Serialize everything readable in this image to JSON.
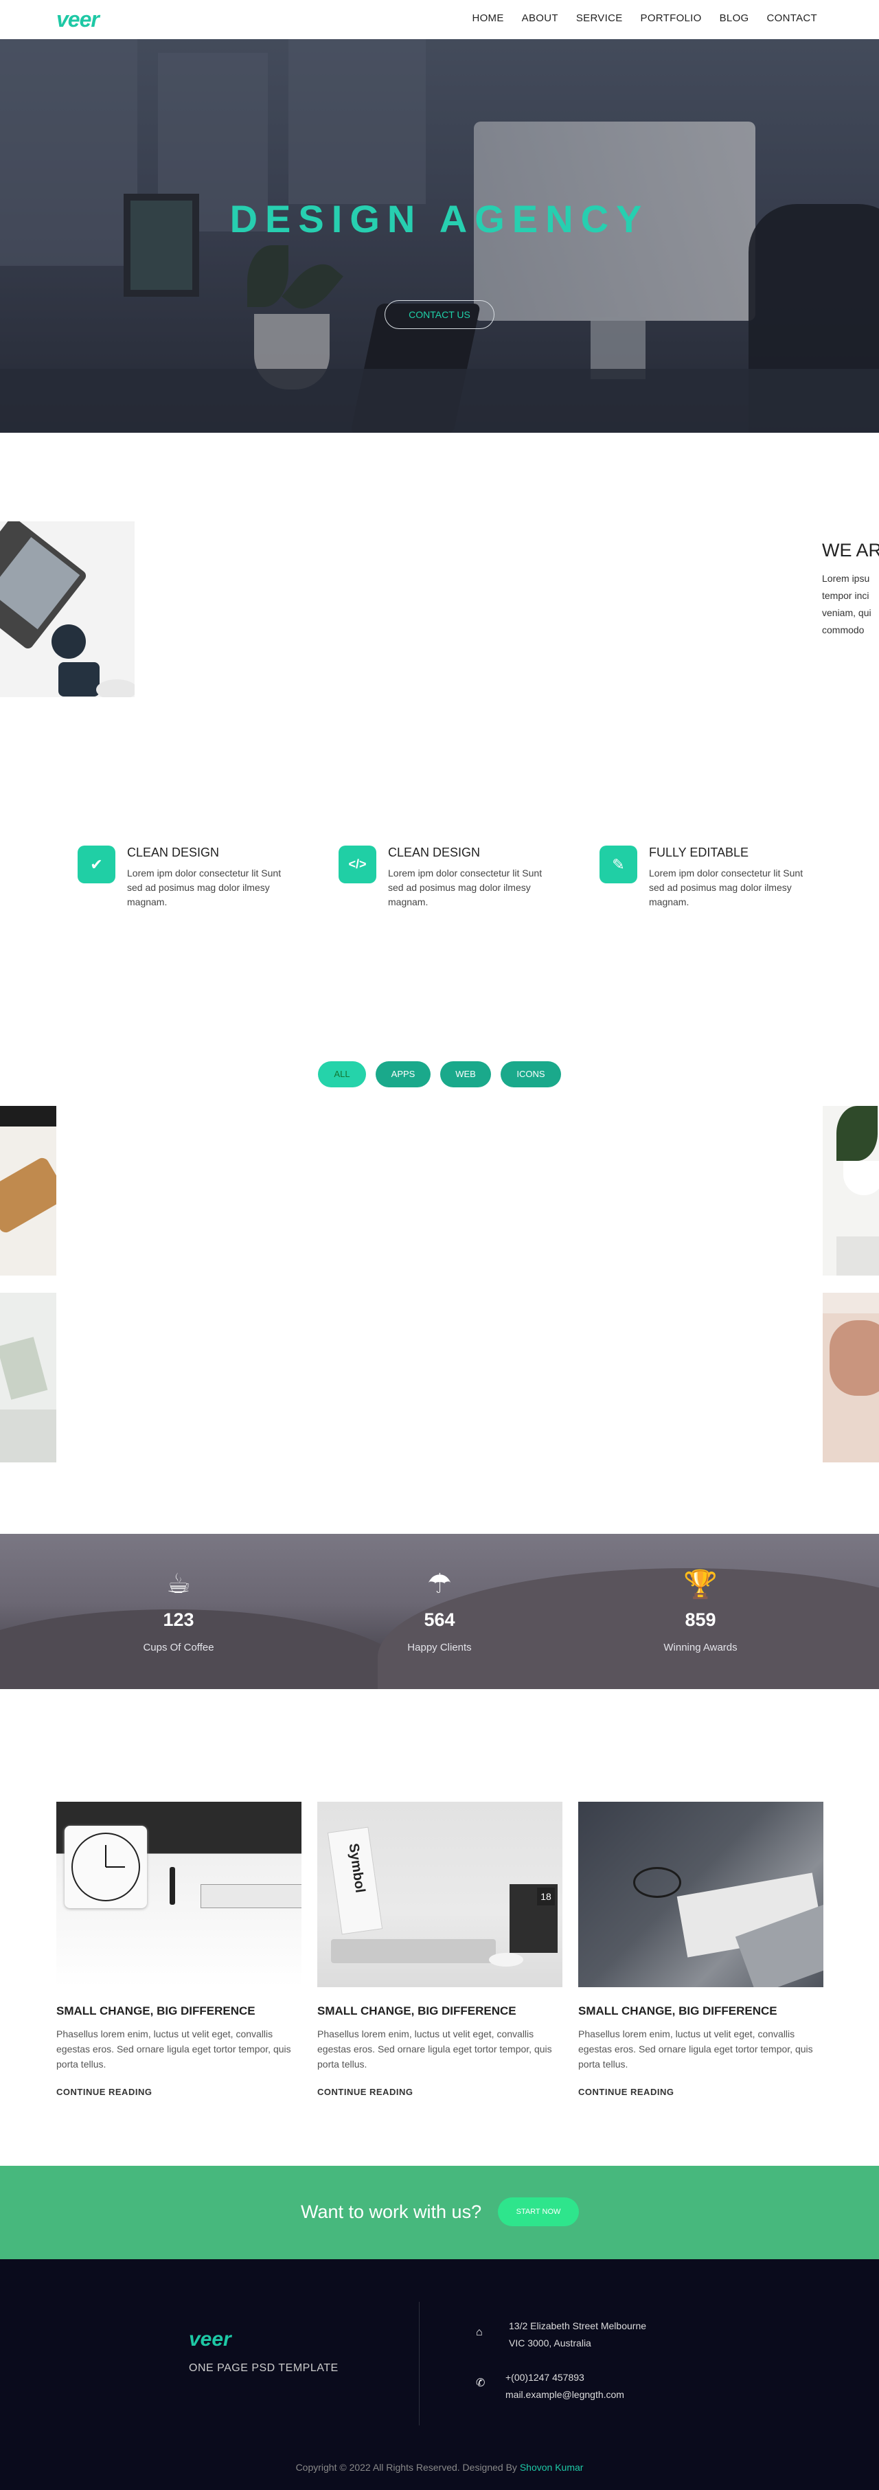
{
  "brand": {
    "logo": "veer"
  },
  "nav": {
    "items": [
      "HOME",
      "ABOUT",
      "SERVICE",
      "PORTFOLIO",
      "BLOG",
      "CONTACT"
    ]
  },
  "hero": {
    "title": "DESIGN AGENCY",
    "button": "CONTACT US"
  },
  "about": {
    "title": "WE AR",
    "lines": [
      "Lorem ipsu",
      "tempor inci",
      "veniam, qui",
      "commodo"
    ]
  },
  "features": [
    {
      "icon": "check-circle-icon",
      "title": "CLEAN DESIGN",
      "text": "Lorem ipm dolor consectetur lit Sunt sed ad posimus mag dolor ilmesy magnam."
    },
    {
      "icon": "code-icon",
      "title": "CLEAN DESIGN",
      "text": "Lorem ipm dolor consectetur lit Sunt sed ad posimus mag dolor ilmesy magnam."
    },
    {
      "icon": "edit-icon",
      "title": "FULLY EDITABLE",
      "text": "Lorem ipm dolor consectetur lit Sunt sed ad posimus mag dolor ilmesy magnam."
    }
  ],
  "portfolio": {
    "filters": [
      "ALL",
      "APPS",
      "WEB",
      "ICONS"
    ],
    "active": "ALL"
  },
  "stats": [
    {
      "icon": "coffee-cup-icon",
      "value": "123",
      "label": "Cups Of Coffee"
    },
    {
      "icon": "umbrella-icon",
      "value": "564",
      "label": "Happy Clients"
    },
    {
      "icon": "trophy-icon",
      "value": "859",
      "label": "Winning Awards"
    }
  ],
  "blog": [
    {
      "title": "SMALL CHANGE, BIG DIFFERENCE",
      "text": "Phasellus lorem enim, luctus ut velit eget, convallis egestas eros. Sed ornare ligula eget tortor tempor, quis porta tellus.",
      "link": "CONTINUE READING"
    },
    {
      "title": "SMALL CHANGE, BIG DIFFERENCE",
      "text": "Phasellus lorem enim, luctus ut velit eget, convallis egestas eros. Sed ornare ligula eget tortor tempor, quis porta tellus.",
      "link": "CONTINUE READING"
    },
    {
      "title": "SMALL CHANGE, BIG DIFFERENCE",
      "text": "Phasellus lorem enim, luctus ut velit eget, convallis egestas eros. Sed ornare ligula eget tortor tempor, quis porta tellus.",
      "link": "CONTINUE READING"
    }
  ],
  "blog_images": {
    "book_label": "Symbol",
    "calendar_day": "18"
  },
  "cta": {
    "question": "Want to work with us?",
    "button": "START NOW"
  },
  "footer": {
    "logo": "veer",
    "tagline": "ONE PAGE PSD TEMPLATE",
    "address": [
      "13/2 Elizabeth Street Melbourne",
      "VIC 3000, Australia"
    ],
    "phone": "+(00)1247 457893",
    "email": "mail.example@legngth.com",
    "copyright": "Copyright © 2022 All Rights Reserved. Designed By",
    "designer": "Shovon Kumar"
  },
  "colors": {
    "accent": "#1ec8a5",
    "cta_bg": "#47b87d",
    "footer_bg": "#0a0b1c"
  }
}
